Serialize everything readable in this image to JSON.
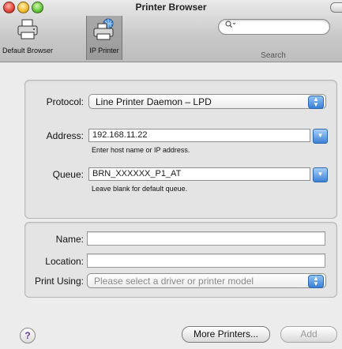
{
  "window": {
    "title": "Printer Browser"
  },
  "toolbar": {
    "items": [
      {
        "label": "Default Browser",
        "icon": "printer-icon",
        "selected": false
      },
      {
        "label": "IP Printer",
        "icon": "network-printer-icon",
        "selected": true
      }
    ],
    "search": {
      "placeholder": "",
      "label": "Search",
      "icon": "magnifier-icon"
    }
  },
  "ip_group": {
    "protocol": {
      "label": "Protocol:",
      "value": "Line Printer Daemon – LPD"
    },
    "address": {
      "label": "Address:",
      "value": "192.168.11.22",
      "hint": "Enter host name or IP address."
    },
    "queue": {
      "label": "Queue:",
      "value": "BRN_XXXXXX_P1_AT",
      "hint": "Leave blank for default queue."
    }
  },
  "info_group": {
    "name": {
      "label": "Name:",
      "value": ""
    },
    "location": {
      "label": "Location:",
      "value": ""
    },
    "print_using": {
      "label": "Print Using:",
      "value": "Please select a driver or printer model",
      "enabled": false
    }
  },
  "footer": {
    "help_glyph": "?",
    "more_printers_label": "More Printers...",
    "add_label": "Add",
    "add_enabled": false
  },
  "colors": {
    "accent": "#3d81d6",
    "window_bg": "#ececec"
  }
}
